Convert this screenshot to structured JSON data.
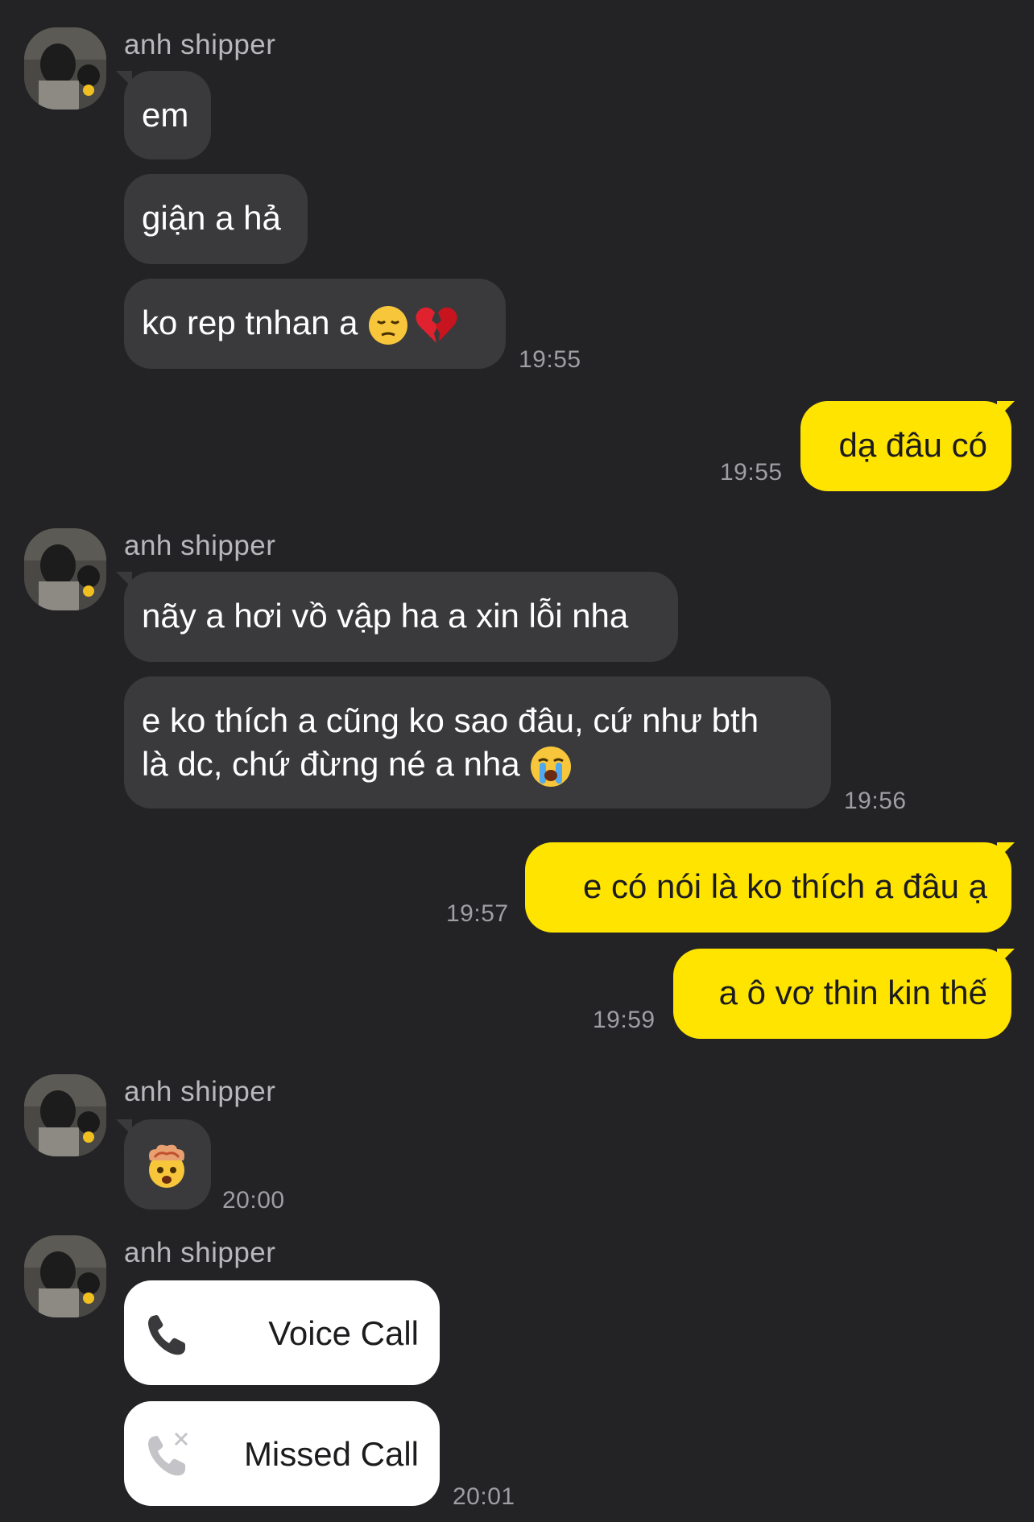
{
  "conversation": {
    "group1": {
      "sender": "anh shipper",
      "messages": [
        "em",
        "giận a hả",
        "ko rep tnhan a "
      ],
      "time": "19:55"
    },
    "reply1": {
      "text": "dạ đâu có",
      "time": "19:55"
    },
    "group2": {
      "sender": "anh shipper",
      "messages": [
        "nãy a hơi vồ vập ha a xin lỗi nha",
        "e ko thích a cũng ko sao đâu, cứ như bth",
        "là dc, chứ đừng né a nha "
      ],
      "time": "19:56"
    },
    "reply2": {
      "text": "e có nói là ko thích a đâu ạ",
      "time": "19:57"
    },
    "reply3": {
      "text": "a ô vơ thin kin thế",
      "time": "19:59"
    },
    "group3": {
      "sender": "anh shipper",
      "time": "20:00"
    },
    "group4": {
      "sender": "anh shipper",
      "voice_call_label": "Voice Call",
      "missed_call_label": "Missed Call",
      "time": "20:01"
    }
  },
  "icons": {
    "pensive": "pensive-face-emoji",
    "broken_heart": "broken-heart-emoji",
    "crying": "loudly-crying-face-emoji",
    "exploding": "exploding-head-emoji",
    "phone": "phone-icon",
    "missed_phone": "missed-call-icon"
  },
  "colors": {
    "background": "#232325",
    "incoming_bubble": "#3a3a3c",
    "outgoing_bubble": "#ffe400",
    "call_card": "#ffffff"
  }
}
